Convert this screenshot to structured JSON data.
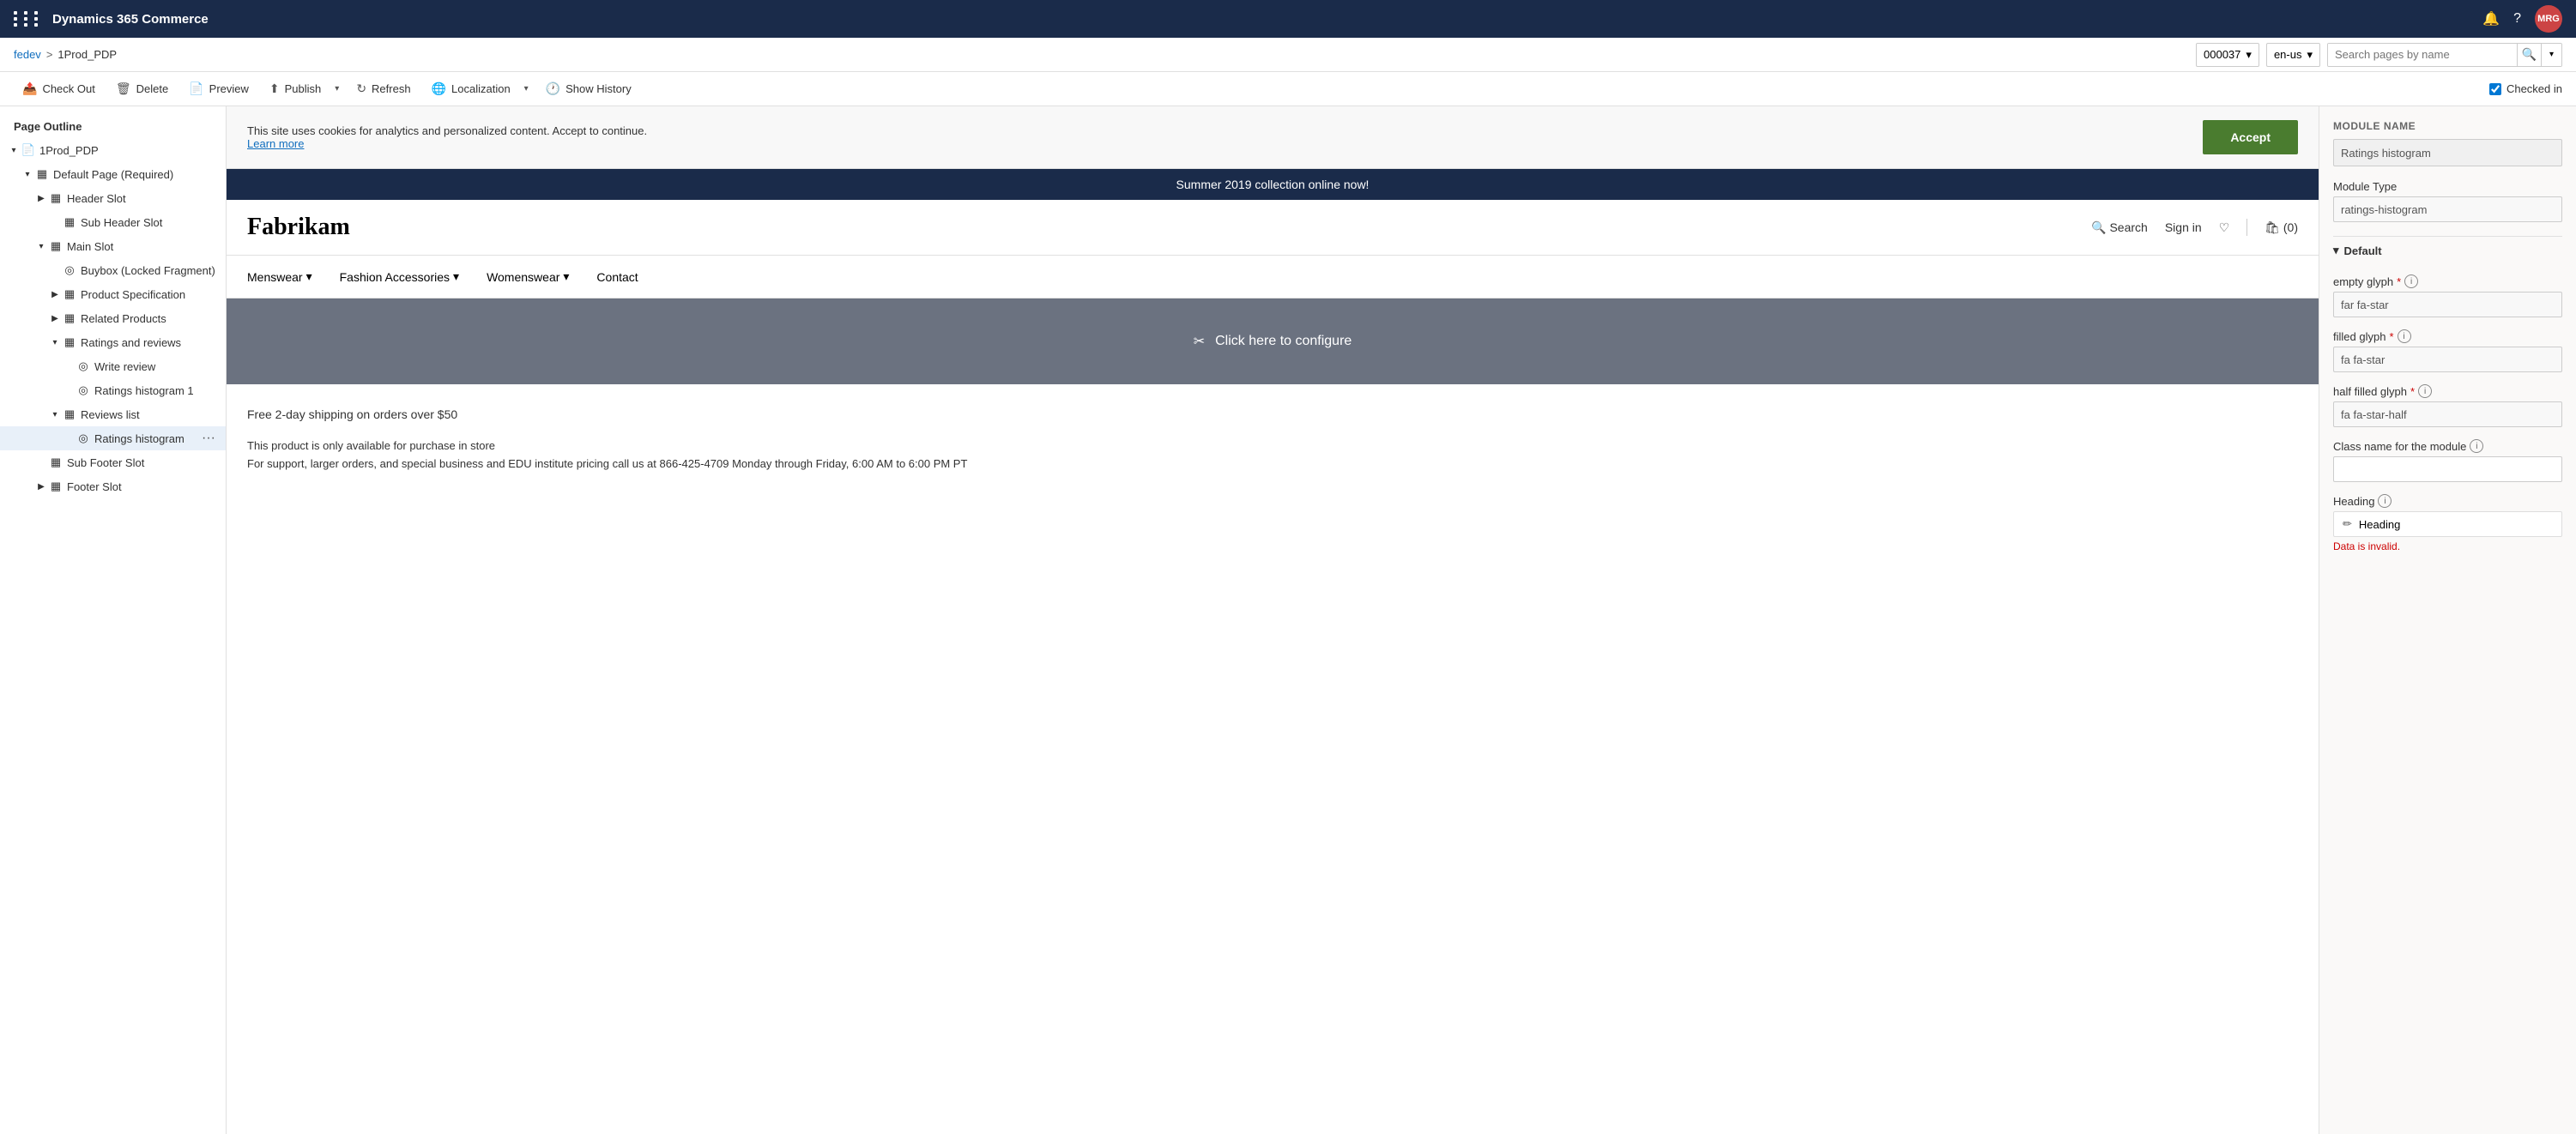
{
  "app": {
    "title": "Dynamics 365 Commerce",
    "avatar": "MRG"
  },
  "breadcrumb": {
    "link": "fedev",
    "separator": ">",
    "current": "1Prod_PDP"
  },
  "controls_right": {
    "store_id": "000037",
    "language": "en-us",
    "search_placeholder": "Search pages by name",
    "checked_in_label": "Checked in"
  },
  "toolbar": {
    "checkout_label": "Check Out",
    "delete_label": "Delete",
    "preview_label": "Preview",
    "publish_label": "Publish",
    "refresh_label": "Refresh",
    "localization_label": "Localization",
    "show_history_label": "Show History"
  },
  "sidebar": {
    "title": "Page Outline",
    "items": [
      {
        "id": "1prod-pdp",
        "label": "1Prod_PDP",
        "level": 0,
        "expanded": true,
        "icon": "page",
        "expander": "▾"
      },
      {
        "id": "default-page",
        "label": "Default Page (Required)",
        "level": 1,
        "expanded": true,
        "icon": "container",
        "expander": "▾"
      },
      {
        "id": "header-slot",
        "label": "Header Slot",
        "level": 2,
        "expanded": false,
        "icon": "container",
        "expander": "▶"
      },
      {
        "id": "sub-header-slot",
        "label": "Sub Header Slot",
        "level": 3,
        "expanded": false,
        "icon": "container",
        "expander": ""
      },
      {
        "id": "main-slot",
        "label": "Main Slot",
        "level": 2,
        "expanded": true,
        "icon": "container",
        "expander": "▾"
      },
      {
        "id": "buybox",
        "label": "Buybox (Locked Fragment)",
        "level": 3,
        "expanded": false,
        "icon": "fragment",
        "expander": ""
      },
      {
        "id": "product-spec",
        "label": "Product Specification",
        "level": 3,
        "expanded": false,
        "icon": "container",
        "expander": "▶"
      },
      {
        "id": "related-products",
        "label": "Related Products",
        "level": 3,
        "expanded": false,
        "icon": "container",
        "expander": "▶"
      },
      {
        "id": "ratings-reviews",
        "label": "Ratings and reviews",
        "level": 3,
        "expanded": true,
        "icon": "container",
        "expander": "▾"
      },
      {
        "id": "write-review",
        "label": "Write review",
        "level": 4,
        "expanded": false,
        "icon": "module",
        "expander": ""
      },
      {
        "id": "ratings-histogram-1",
        "label": "Ratings histogram 1",
        "level": 4,
        "expanded": false,
        "icon": "module",
        "expander": ""
      },
      {
        "id": "reviews-list",
        "label": "Reviews list",
        "level": 3,
        "expanded": true,
        "icon": "container",
        "expander": "▾"
      },
      {
        "id": "ratings-histogram",
        "label": "Ratings histogram",
        "level": 4,
        "expanded": false,
        "icon": "module",
        "expander": "",
        "selected": true
      },
      {
        "id": "sub-footer-slot",
        "label": "Sub Footer Slot",
        "level": 2,
        "expanded": false,
        "icon": "container",
        "expander": ""
      },
      {
        "id": "footer-slot",
        "label": "Footer Slot",
        "level": 2,
        "expanded": false,
        "icon": "container",
        "expander": "▶"
      }
    ]
  },
  "preview": {
    "cookie_text": "This site uses cookies for analytics and personalized content. Accept to continue.",
    "cookie_link": "Learn more",
    "accept_btn": "Accept",
    "marquee": "Summer 2019 collection online now!",
    "logo": "Fabrikam",
    "search_label": "Search",
    "sign_in_label": "Sign in",
    "cart_label": "(0)",
    "menu_items": [
      {
        "label": "Menswear",
        "has_arrow": true
      },
      {
        "label": "Fashion Accessories",
        "has_arrow": true
      },
      {
        "label": "Womenswear",
        "has_arrow": true
      },
      {
        "label": "Contact",
        "has_arrow": false
      }
    ],
    "configure_text": "Click here to configure",
    "shipping_text": "Free 2-day shipping on orders over $50",
    "info_text": "This product is only available for purchase in store\nFor support, larger orders, and special business and EDU institute pricing call us at 866-425-4709 Monday through Friday, 6:00 AM to 6:00 PM PT"
  },
  "right_panel": {
    "module_name_label": "MODULE NAME",
    "module_name_value": "Ratings histogram",
    "module_type_label": "Module Type",
    "module_type_value": "ratings-histogram",
    "default_section": "Default",
    "empty_glyph_label": "empty glyph",
    "empty_glyph_value": "far fa-star",
    "filled_glyph_label": "filled glyph",
    "filled_glyph_value": "fa fa-star",
    "half_filled_glyph_label": "half filled glyph",
    "half_filled_glyph_value": "fa fa-star-half",
    "class_name_label": "Class name for the module",
    "heading_label": "Heading",
    "heading_value": "Heading",
    "error_text": "Data is invalid."
  }
}
